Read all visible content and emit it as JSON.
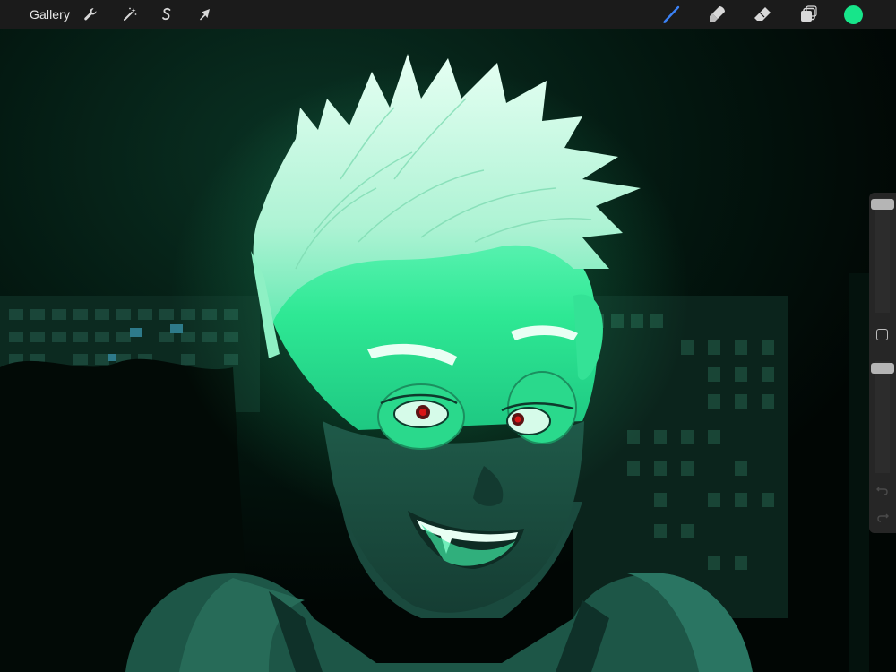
{
  "toolbar": {
    "gallery_label": "Gallery",
    "left_tools": [
      {
        "name": "actions",
        "icon": "wrench-icon"
      },
      {
        "name": "adjustments",
        "icon": "magic-wand-icon"
      },
      {
        "name": "selection",
        "icon": "selection-s-icon"
      },
      {
        "name": "transform",
        "icon": "cursor-arrow-icon"
      }
    ],
    "right_tools": [
      {
        "name": "brush",
        "icon": "brush-icon",
        "active": true
      },
      {
        "name": "smudge",
        "icon": "smudge-icon"
      },
      {
        "name": "eraser",
        "icon": "eraser-icon"
      },
      {
        "name": "layers",
        "icon": "layers-icon"
      }
    ],
    "current_color": "#17e58a",
    "active_tool_color": "#3b82f6",
    "icon_color": "#d8d8d8"
  },
  "sidebar": {
    "brush_size_icon": "slider-thumb",
    "modify_icon": "square-icon",
    "opacity_icon": "slider-thumb",
    "undo_icon": "undo-arrow-icon",
    "redo_icon": "redo-arrow-icon"
  },
  "artwork": {
    "palette": {
      "background": "#020a06",
      "sky_glow": "#06241a",
      "building": "#0d2a20",
      "window": "#1a4a3a",
      "skin_light": "#3cf0a0",
      "skin_mid": "#1fd688",
      "skin_shadow": "#1a4a3e",
      "hair": "#bff6de",
      "eye_red": "#d91616"
    }
  }
}
